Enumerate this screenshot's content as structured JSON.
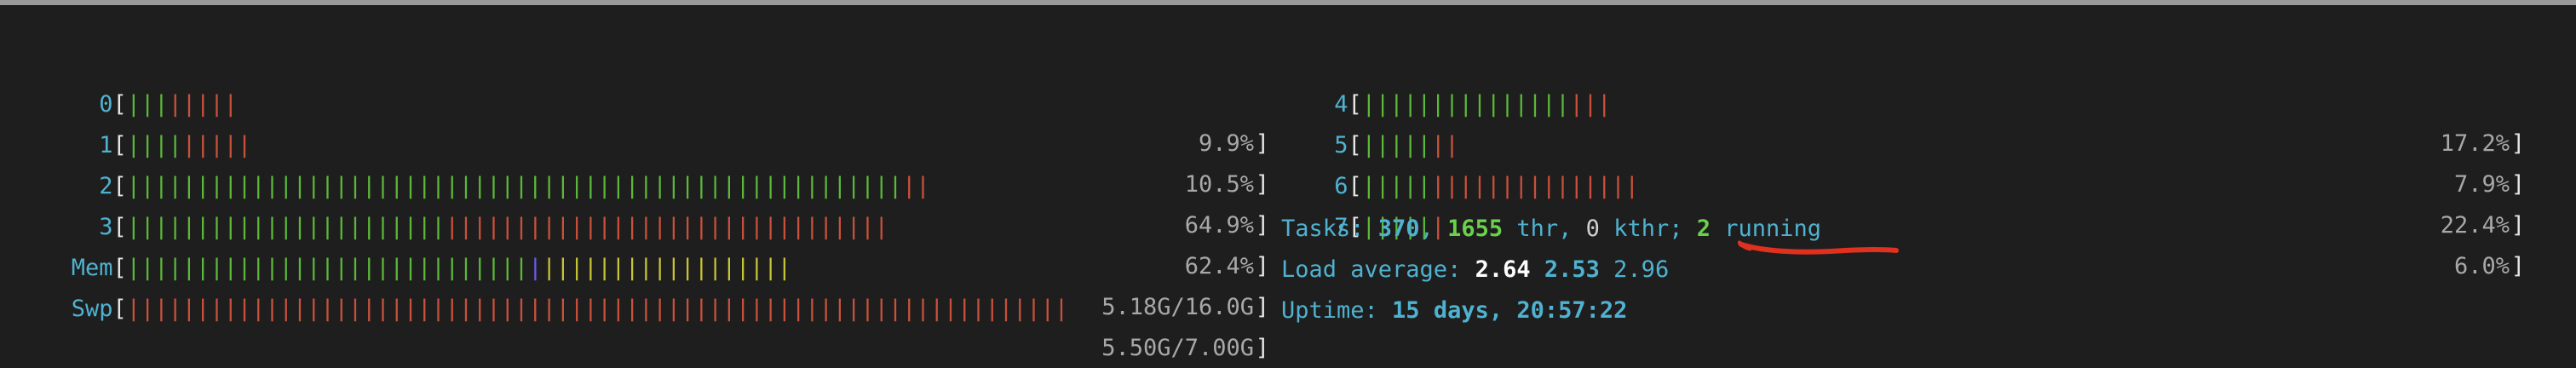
{
  "meters": [
    {
      "id": "cpu0",
      "label": "0",
      "percent_text": "9.9%",
      "segments": [
        {
          "c": "g",
          "n": 3
        },
        {
          "c": "r",
          "n": 5
        }
      ]
    },
    {
      "id": "cpu1",
      "label": "1",
      "percent_text": "10.5%",
      "segments": [
        {
          "c": "g",
          "n": 4
        },
        {
          "c": "r",
          "n": 5
        }
      ]
    },
    {
      "id": "cpu2",
      "label": "2",
      "percent_text": "64.9%",
      "segments": [
        {
          "c": "g",
          "n": 56
        },
        {
          "c": "r",
          "n": 2
        }
      ]
    },
    {
      "id": "cpu3",
      "label": "3",
      "percent_text": "62.4%",
      "segments": [
        {
          "c": "g",
          "n": 23
        },
        {
          "c": "r",
          "n": 32
        }
      ]
    },
    {
      "id": "cpu4",
      "label": "4",
      "percent_text": "17.2%",
      "segments": [
        {
          "c": "g",
          "n": 15
        },
        {
          "c": "r",
          "n": 3
        }
      ]
    },
    {
      "id": "cpu5",
      "label": "5",
      "percent_text": "7.9%",
      "segments": [
        {
          "c": "g",
          "n": 5
        },
        {
          "c": "r",
          "n": 2
        }
      ]
    },
    {
      "id": "cpu6",
      "label": "6",
      "percent_text": "22.4%",
      "segments": [
        {
          "c": "g",
          "n": 5
        },
        {
          "c": "r",
          "n": 15
        }
      ]
    },
    {
      "id": "cpu7",
      "label": "7",
      "percent_text": "6.0%",
      "segments": [
        {
          "c": "g",
          "n": 5
        },
        {
          "c": "r",
          "n": 1
        }
      ]
    },
    {
      "id": "mem",
      "label": "Mem",
      "percent_text": "5.18G/16.0G",
      "segments": [
        {
          "c": "g",
          "n": 29
        },
        {
          "c": "b",
          "n": 1
        },
        {
          "c": "y",
          "n": 18
        }
      ]
    },
    {
      "id": "swp",
      "label": "Swp",
      "percent_text": "5.50G/7.00G",
      "segments": [
        {
          "c": "r",
          "n": 68
        }
      ]
    }
  ],
  "tasks": {
    "label": "Tasks: ",
    "count": "370",
    "sep1": ", ",
    "threads": "1655",
    "thr_label": " thr",
    "sep2": ", ",
    "kthr": "0",
    "kthr_label": " kthr",
    "sep3": "; ",
    "running": "2",
    "running_label": " running"
  },
  "load": {
    "label": "Load average: ",
    "one": "2.64",
    "five": "2.53",
    "fifteen": "2.96"
  },
  "uptime": {
    "label": "Uptime: ",
    "value": "15 days, 20:57:22"
  },
  "colors": {
    "background": "#1e1e1e",
    "label_cyan": "#4fb2d0",
    "bar_green": "#5bb83a",
    "bar_red": "#c9513b",
    "bar_blue": "#6a5ae8",
    "bar_yellow": "#c6c435",
    "annotation_red": "#e0301e"
  }
}
